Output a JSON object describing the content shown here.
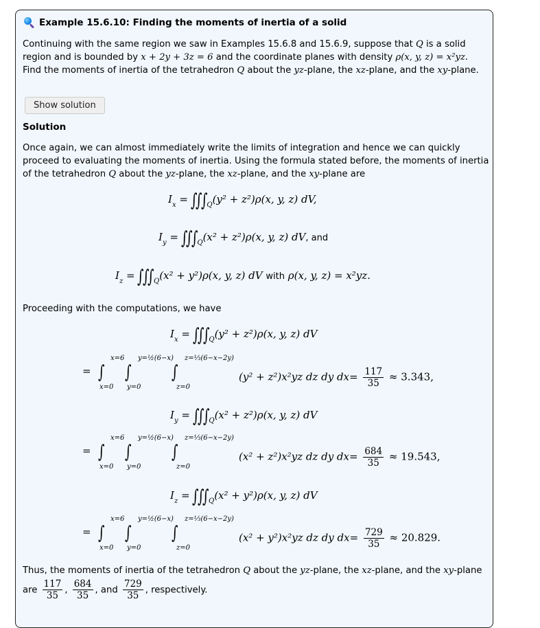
{
  "example": {
    "icon": "magnifier-icon",
    "title": "Example 15.6.10: Finding the moments of inertia of a solid",
    "problem": {
      "line1_a": "Continuing with the same region we saw in Examples 15.6.8 and 15.6.9, suppose that ",
      "Q": "Q",
      "line1_b": " is a solid",
      "line2_a": "region and is bounded by ",
      "plane_eq": "x + 2y + 3z = 6",
      "line2_b": " and the coordinate planes with density ",
      "density": "ρ(x, y, z) = x²yz.",
      "line3_a": "Find the moments of inertia of the tetrahedron ",
      "line3_b": " about the ",
      "yz": "yz",
      "line3_c": "-plane, the ",
      "xz": "xz",
      "line3_d": "-plane, and the ",
      "xy": "xy",
      "line3_e": "-plane."
    },
    "show_solution_label": "Show solution",
    "solution_heading": "Solution",
    "solution_intro": {
      "line1": "Once again, we can almost immediately write the limits of integration and hence we can quickly",
      "line2": "proceed to evaluating the moments of inertia. Using the formula stated before, the moments of inertia",
      "line3_a": "of the tetrahedron ",
      "line3_b": " about the ",
      "line3_c": "-plane, the ",
      "line3_d": "-plane, and the ",
      "line3_e": "-plane are"
    },
    "formulas": {
      "Ix_lhs": "I",
      "Ix_sub": "x",
      "Iy_sub": "y",
      "Iz_sub": "z",
      "equals": "=",
      "region": "Q",
      "Ix_integrand": "(y² + z²)ρ(x, y, z) dV,",
      "Iy_integrand": "(x² + z²)ρ(x, y, z) dV",
      "Iy_suffix": ", and",
      "Iz_integrand": "(x² + y²)ρ(x, y, z) dV",
      "with_word": "with",
      "Iz_density": "ρ(x, y, z) = x²yz."
    },
    "proceeding": "Proceeding with the computations, we have",
    "computations": [
      {
        "sub": "x",
        "integrand": "(y² + z²)ρ(x, y, z) dV",
        "x_upper": "x=6",
        "x_lower": "x=0",
        "y_upper": "y=½(6−x)",
        "y_lower": "y=0",
        "z_upper": "z=⅓(6−x−2y)",
        "z_lower": "z=0",
        "iterated": "(y² + z²)x²yz dz dy dx=",
        "num": "117",
        "den": "35",
        "approx": "≈ 3.343,"
      },
      {
        "sub": "y",
        "integrand": "(x² + z²)ρ(x, y, z) dV",
        "x_upper": "x=6",
        "x_lower": "x=0",
        "y_upper": "y=½(6−x)",
        "y_lower": "y=0",
        "z_upper": "z=⅓(6−x−2y)",
        "z_lower": "z=0",
        "iterated": "(x² + z²)x²yz dz dy dx=",
        "num": "684",
        "den": "35",
        "approx": "≈ 19.543,"
      },
      {
        "sub": "z",
        "integrand": "(x² + y²)ρ(x, y, z) dV",
        "x_upper": "x=6",
        "x_lower": "x=0",
        "y_upper": "y=½(6−x)",
        "y_lower": "y=0",
        "z_upper": "z=⅓(6−x−2y)",
        "z_lower": "z=0",
        "iterated": "(x² + y²)x²yz dz dy dx=",
        "num": "729",
        "den": "35",
        "approx": "≈ 20.829."
      }
    ],
    "conclusion": {
      "line1_a": "Thus, the moments of inertia of the tetrahedron ",
      "line1_b": " about the ",
      "line1_c": "-plane, the ",
      "line1_d": "-plane, and the ",
      "line1_e": "-plane",
      "are": "are",
      "comma": ",",
      "and": ", and",
      "respectively": ", respectively.",
      "fractions": [
        {
          "num": "117",
          "den": "35"
        },
        {
          "num": "684",
          "den": "35"
        },
        {
          "num": "729",
          "den": "35"
        }
      ]
    }
  }
}
